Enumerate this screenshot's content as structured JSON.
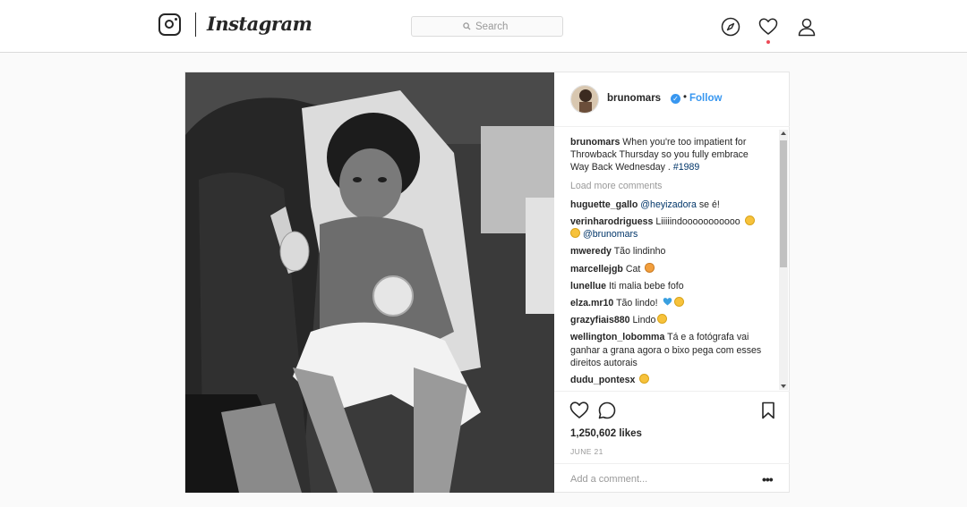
{
  "nav": {
    "logo_icon": "instagram-camera-icon",
    "wordmark": "Instagram",
    "search_placeholder": "Search",
    "icons": [
      "compass-icon",
      "heart-icon",
      "profile-icon"
    ],
    "notification_color": "#ed4956"
  },
  "post": {
    "username": "brunomars",
    "verified_icon": "verified-badge-icon",
    "separator": "•",
    "follow_label": "Follow",
    "accent_color": "#3897f0",
    "caption": {
      "user": "brunomars",
      "text": "When you're too impatient for Throwback Thursday so you fully embrace Way Back Wednesday . ",
      "hashtag": "#1989"
    },
    "load_more": "Load more comments",
    "comments": [
      {
        "user": "huguette_gallo",
        "mention": "@heyizadora",
        "text": " se é!"
      },
      {
        "user": "verinharodriguess",
        "text": "Liiiiindooooooooooo ",
        "emoji": "smiling-face-emoji",
        "emoji2": "smiling-face-emoji",
        "mention": "@brunomars"
      },
      {
        "user": "mweredy",
        "text": "Tão lindinho"
      },
      {
        "user": "marcellejgb",
        "text": "Cat ",
        "emoji": "cat-face-emoji"
      },
      {
        "user": "lunellue",
        "text": "Iti malia bebe fofo"
      },
      {
        "user": "elza.mr10",
        "text": "Tão lindo! ",
        "emoji": "blue-heart-emoji",
        "emoji2": "heart-eyes-emoji"
      },
      {
        "user": "grazyfiais880",
        "text": "Lindo",
        "emoji": "smiling-face-emoji"
      },
      {
        "user": "wellington_lobomma",
        "text": "Tá e a fotógrafa vai ganhar a grana agora o bixo pega com esses direitos autorais"
      },
      {
        "user": "dudu_pontesx",
        "emoji": "grinning-face-emoji"
      }
    ],
    "action_icons": [
      "like-heart-icon",
      "comment-bubble-icon",
      "bookmark-icon"
    ],
    "likes": "1,250,602 likes",
    "date": "JUNE 21",
    "add_comment_placeholder": "Add a comment...",
    "more_label": "•••"
  }
}
